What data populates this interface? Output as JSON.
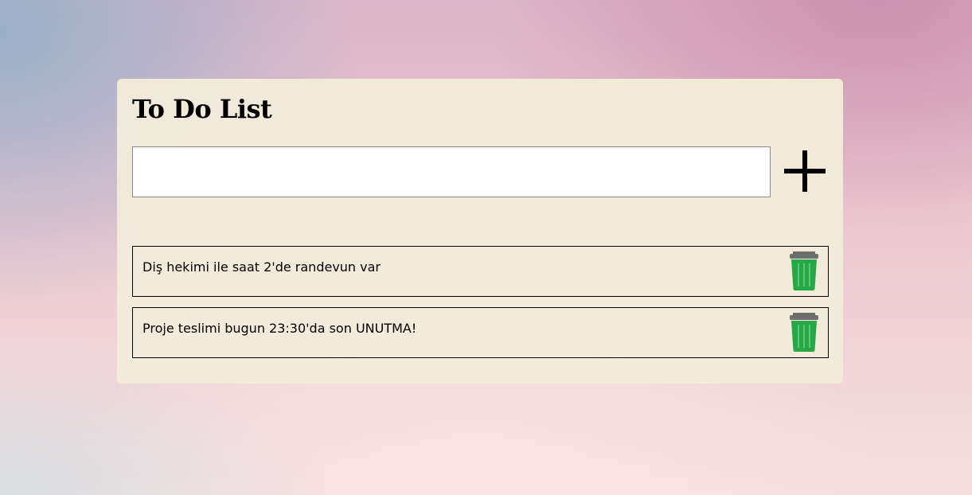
{
  "app": {
    "title": "To Do List"
  },
  "input": {
    "value": "",
    "placeholder": ""
  },
  "add_button": {
    "icon": "plus-icon"
  },
  "todos": [
    {
      "text": "Diş hekimi ile saat 2'de randevun var",
      "delete_icon": "trash-icon"
    },
    {
      "text": "Proje teslimi bugun 23:30'da son UNUTMA!",
      "delete_icon": "trash-icon"
    }
  ],
  "colors": {
    "card_background": "#f2ecda",
    "trash_green": "#27a846",
    "text": "#000000"
  }
}
